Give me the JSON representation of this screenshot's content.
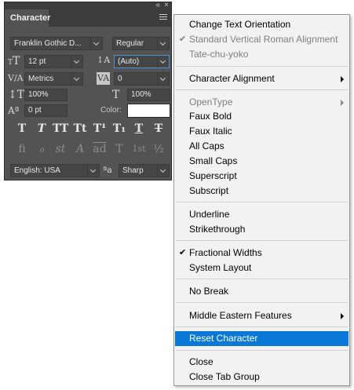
{
  "panel": {
    "tab_label": "Character",
    "collapse_glyph": "«",
    "close_glyph": "×",
    "font_family": "Franklin Gothic D...",
    "font_style": "Regular",
    "font_size": "12 pt",
    "leading": "(Auto)",
    "kerning": "Metrics",
    "tracking": "0",
    "vertical_scale": "100%",
    "horizontal_scale": "100%",
    "baseline_shift": "0 pt",
    "color_label": "Color:",
    "color_value": "#ffffff",
    "language": "English: USA",
    "antialias": "Sharp",
    "style_buttons": [
      "T",
      "T",
      "TT",
      "Tt",
      "T¹",
      "T₁",
      "T",
      "T"
    ],
    "opentype_buttons": [
      "fi",
      "ℴ",
      "st",
      "A",
      "ad",
      "T",
      "1st",
      "½"
    ]
  },
  "menu": {
    "items": [
      {
        "label": "Change Text Orientation",
        "checked": false,
        "disabled": false,
        "submenu": false
      },
      {
        "label": "Standard Vertical Roman Alignment",
        "checked": true,
        "disabled": true,
        "submenu": false
      },
      {
        "label": "Tate-chu-yoko",
        "checked": false,
        "disabled": true,
        "submenu": false
      },
      {
        "label": "Character Alignment",
        "checked": false,
        "disabled": false,
        "submenu": true
      },
      {
        "label": "OpenType",
        "checked": false,
        "disabled": true,
        "submenu": true
      },
      {
        "label": "Faux Bold",
        "checked": false,
        "disabled": false,
        "submenu": false
      },
      {
        "label": "Faux Italic",
        "checked": false,
        "disabled": false,
        "submenu": false
      },
      {
        "label": "All Caps",
        "checked": false,
        "disabled": false,
        "submenu": false
      },
      {
        "label": "Small Caps",
        "checked": false,
        "disabled": false,
        "submenu": false
      },
      {
        "label": "Superscript",
        "checked": false,
        "disabled": false,
        "submenu": false
      },
      {
        "label": "Subscript",
        "checked": false,
        "disabled": false,
        "submenu": false
      },
      {
        "label": "Underline",
        "checked": false,
        "disabled": false,
        "submenu": false
      },
      {
        "label": "Strikethrough",
        "checked": false,
        "disabled": false,
        "submenu": false
      },
      {
        "label": "Fractional Widths",
        "checked": true,
        "disabled": false,
        "submenu": false
      },
      {
        "label": "System Layout",
        "checked": false,
        "disabled": false,
        "submenu": false
      },
      {
        "label": "No Break",
        "checked": false,
        "disabled": false,
        "submenu": false
      },
      {
        "label": "Middle Eastern Features",
        "checked": false,
        "disabled": false,
        "submenu": true
      },
      {
        "label": "Reset Character",
        "checked": false,
        "disabled": false,
        "submenu": false,
        "highlighted": true
      },
      {
        "label": "Close",
        "checked": false,
        "disabled": false,
        "submenu": false
      },
      {
        "label": "Close Tab Group",
        "checked": false,
        "disabled": false,
        "submenu": false
      }
    ],
    "check_glyph": "✔",
    "highlight_color": "#0a78d7"
  }
}
